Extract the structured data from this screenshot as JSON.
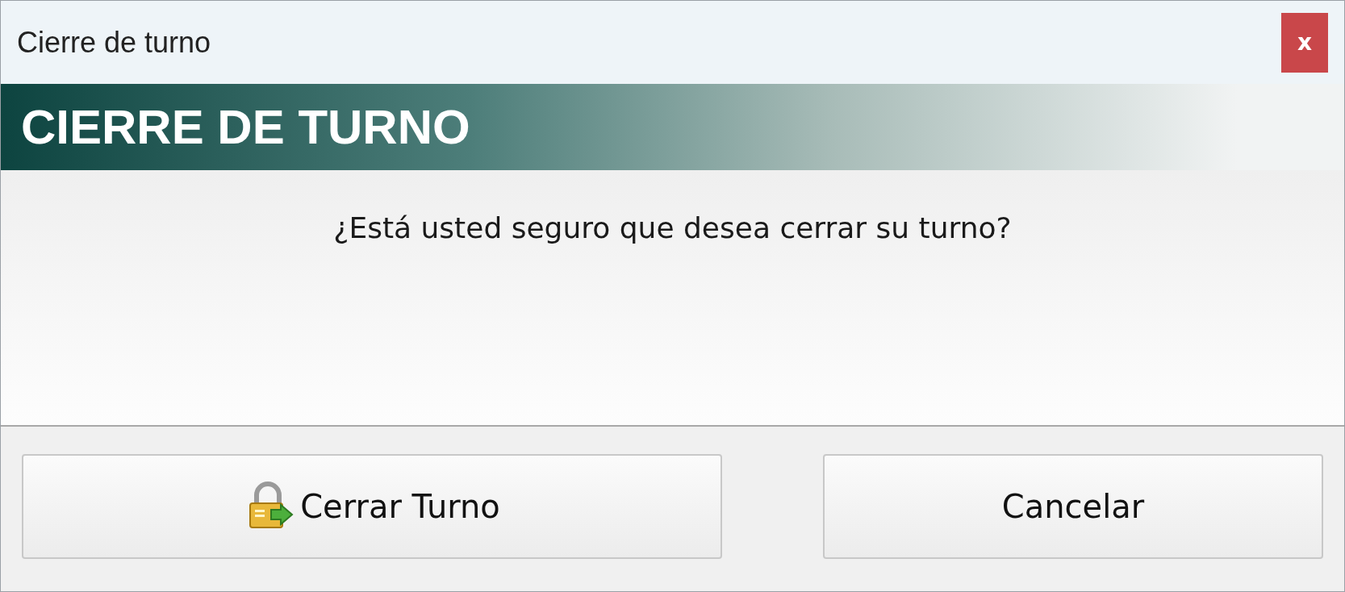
{
  "window": {
    "title": "Cierre de turno",
    "close": "x"
  },
  "header": {
    "title": "CIERRE DE TURNO"
  },
  "message": "¿Está usted seguro que desea cerrar su turno?",
  "buttons": [
    {
      "label": "Cerrar Turno",
      "kind": "lock"
    },
    {
      "label": "Cancelar",
      "kind": "plain"
    }
  ]
}
